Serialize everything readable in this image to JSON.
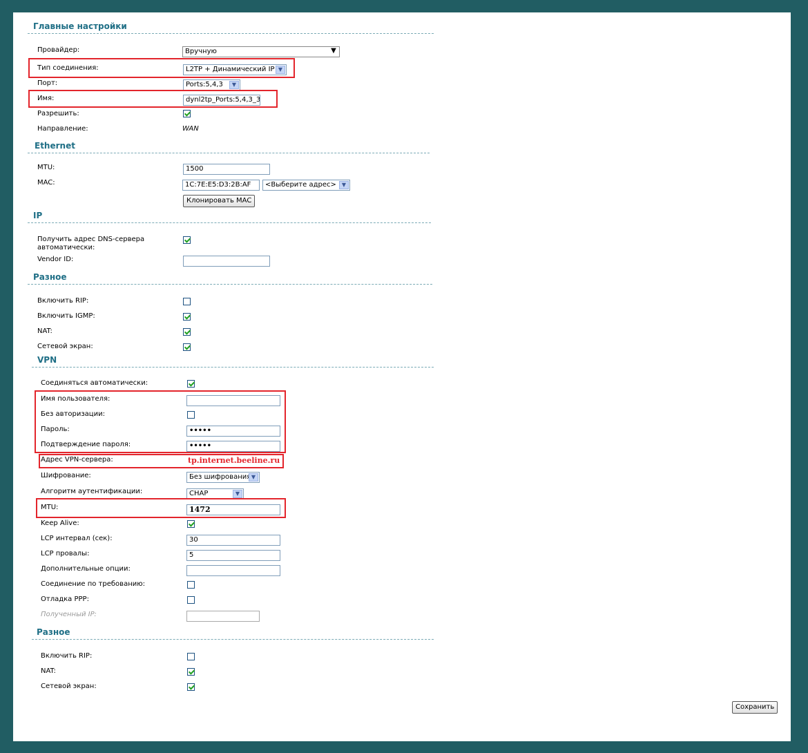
{
  "main": {
    "title": "Главные настройки",
    "provider_label": "Провайдер:",
    "provider_value": "Вручную",
    "conn_type_label": "Тип соединения:",
    "conn_type_value": "L2TP + Динамический IP",
    "port_label": "Порт:",
    "port_value": "Ports:5,4,3",
    "name_label": "Имя:",
    "name_value": "dynl2tp_Ports:5,4,3_3",
    "allow_label": "Разрешить:",
    "allow_checked": true,
    "direction_label": "Направление:",
    "direction_value": "WAN"
  },
  "ethernet": {
    "title": "Ethernet",
    "mtu_label": "MTU:",
    "mtu_value": "1500",
    "mac_label": "MAC:",
    "mac_value": "1C:7E:E5:D3:2B:AF",
    "mac_select": "<Выберите адрес>",
    "clone_button": "Клонировать MAC"
  },
  "ip": {
    "title": "IP",
    "dns_label_1": "Получить адрес DNS-сервера",
    "dns_label_2": "автоматически:",
    "dns_checked": true,
    "vendor_label": "Vendor ID:",
    "vendor_value": ""
  },
  "misc1": {
    "title": "Разное",
    "rip_label": "Включить RIP:",
    "rip_checked": false,
    "igmp_label": "Включить IGMP:",
    "igmp_checked": true,
    "nat_label": "NAT:",
    "nat_checked": true,
    "firewall_label": "Сетевой экран:",
    "firewall_checked": true
  },
  "vpn": {
    "title": "VPN",
    "auto_label": "Соединяться автоматически:",
    "auto_checked": true,
    "user_label": "Имя пользователя:",
    "user_value": "",
    "noauth_label": "Без авторизации:",
    "noauth_checked": false,
    "pass_label": "Пароль:",
    "pass_value": "•••••",
    "pass_confirm_label": "Подтверждение пароля:",
    "pass_confirm_value": "•••••",
    "server_label": "Адрес VPN-сервера:",
    "server_value": "tp.internet.beeline.ru",
    "enc_label": "Шифрование:",
    "enc_value": "Без шифрования",
    "auth_label": "Алгоритм аутентификации:",
    "auth_value": "CHAP",
    "mtu_label": "MTU:",
    "mtu_value": "1472",
    "keepalive_label": "Keep Alive:",
    "keepalive_checked": true,
    "lcp_int_label": "LCP интервал (сек):",
    "lcp_int_value": "30",
    "lcp_fail_label": "LCP провалы:",
    "lcp_fail_value": "5",
    "extra_label": "Дополнительные опции:",
    "extra_value": "",
    "ondemand_label": "Соединение по требованию:",
    "ondemand_checked": false,
    "debug_label": "Отладка PPP:",
    "debug_checked": false,
    "received_ip_label": "Полученный IP:",
    "received_ip_value": ""
  },
  "misc2": {
    "title": "Разное",
    "rip_label": "Включить RIP:",
    "rip_checked": false,
    "nat_label": "NAT:",
    "nat_checked": true,
    "firewall_label": "Сетевой экран:",
    "firewall_checked": true
  },
  "save_button": "Сохранить",
  "colors": {
    "frame": "#215d63",
    "section_title": "#1f6f86",
    "highlight": "#e3242b",
    "check": "#21a121"
  }
}
